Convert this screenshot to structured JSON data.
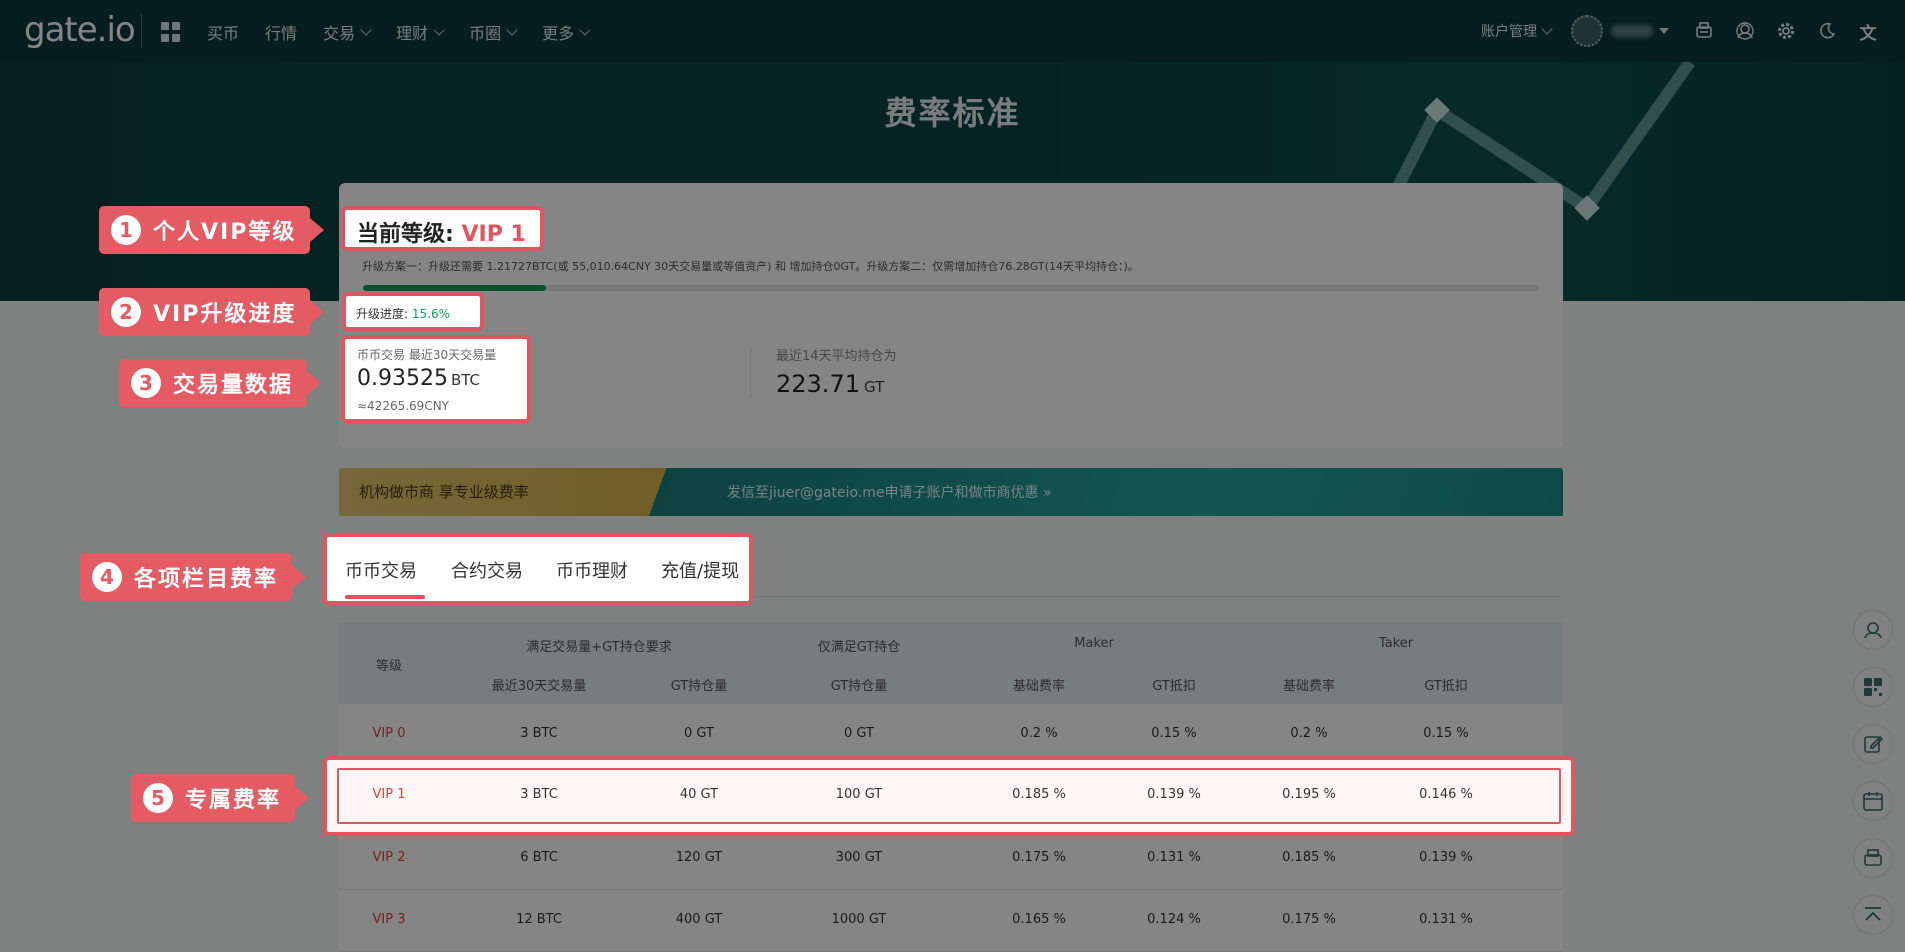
{
  "nav": {
    "logo": "gate.io",
    "items": [
      {
        "label": "买币",
        "has_menu": false
      },
      {
        "label": "行情",
        "has_menu": false
      },
      {
        "label": "交易",
        "has_menu": true
      },
      {
        "label": "理财",
        "has_menu": true
      },
      {
        "label": "币圈",
        "has_menu": true
      },
      {
        "label": "更多",
        "has_menu": true
      }
    ],
    "account": "账户管理",
    "icons": [
      "download-icon",
      "support-icon",
      "gear-icon",
      "moon-icon",
      "translate-icon"
    ]
  },
  "hero": {
    "title": "费率标准"
  },
  "vip": {
    "label": "当前等级:",
    "level": "VIP 1",
    "plan_text": "升级方案一：升级还需要 1.21727BTC(或 55,010.64CNY 30天交易量或等值资产) 和 增加持仓0GT。升级方案二：仅需增加持仓76.28GT(14天平均持仓：)。",
    "progress_label": "升级进度:",
    "progress_value": "15.6%",
    "progress_fraction": 0.156
  },
  "volume": {
    "label": "币币交易 最近30天交易量",
    "value": "0.93525",
    "unit": "BTC",
    "cny": "≈42265.69CNY"
  },
  "gt_hold": {
    "label": "最近14天平均持仓为",
    "value": "223.71",
    "unit": "GT"
  },
  "banner": {
    "left": "机构做市商   享专业级费率",
    "right": "发信至jiuer@gateio.me申请子账户和做市商优惠 »"
  },
  "tabs": [
    "币币交易",
    "合约交易",
    "币币理财",
    "充值/提现"
  ],
  "table": {
    "head": {
      "level": "等级",
      "group1": "满足交易量+GT持仓要求",
      "group2": "仅满足GT持仓",
      "group3": "Maker",
      "group4": "Taker",
      "sub": [
        "最近30天交易量",
        "GT持仓量",
        "GT持仓量",
        "基础费率",
        "GT抵扣",
        "基础费率",
        "GT抵扣"
      ]
    },
    "rows": [
      [
        "VIP 0",
        "3 BTC",
        "0 GT",
        "0 GT",
        "0.2 %",
        "0.15 %",
        "0.2 %",
        "0.15 %"
      ],
      [
        "VIP 1",
        "3 BTC",
        "40 GT",
        "100 GT",
        "0.185 %",
        "0.139 %",
        "0.195 %",
        "0.146 %"
      ],
      [
        "VIP 2",
        "6 BTC",
        "120 GT",
        "300 GT",
        "0.175 %",
        "0.131 %",
        "0.185 %",
        "0.139 %"
      ],
      [
        "VIP 3",
        "12 BTC",
        "400 GT",
        "1000 GT",
        "0.165 %",
        "0.124 %",
        "0.175 %",
        "0.131 %"
      ]
    ]
  },
  "callouts": [
    {
      "num": "1",
      "text": "个人VIP等级"
    },
    {
      "num": "2",
      "text": "VIP升级进度"
    },
    {
      "num": "3",
      "text": "交易量数据"
    },
    {
      "num": "4",
      "text": "各项栏目费率"
    },
    {
      "num": "5",
      "text": "专属费率"
    }
  ],
  "tools": [
    "headset-icon",
    "qr-icon",
    "edit-icon",
    "calendar-icon",
    "app-download-icon",
    "back-to-top-icon"
  ]
}
